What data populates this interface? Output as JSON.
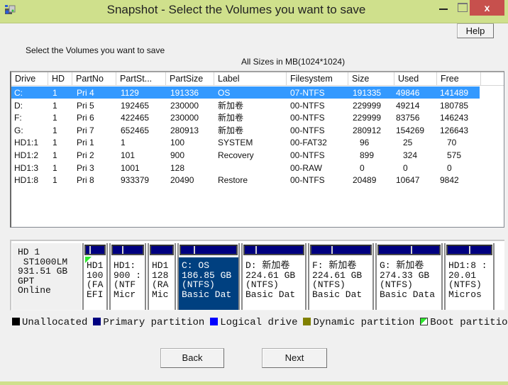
{
  "window": {
    "title": "Snapshot - Select the Volumes you want to save",
    "close_glyph": "x"
  },
  "help_label": "Help",
  "instruction": "Select the Volumes you want to save",
  "sizes_note": "All Sizes in MB(1024*1024)",
  "table": {
    "columns": [
      "Drive",
      "HD",
      "PartNo",
      "PartSt...",
      "PartSize",
      "Label",
      "Filesystem",
      "Size",
      "Used",
      "Free"
    ],
    "rows": [
      {
        "drive": "C:",
        "hd": "1",
        "partno": "Pri  4",
        "partstart": "1129",
        "partsize": "191336",
        "label": "OS",
        "filesystem": "07-NTFS",
        "size": "191335",
        "used": "49846",
        "free": "141489",
        "selected": true
      },
      {
        "drive": "D:",
        "hd": "1",
        "partno": "Pri  5",
        "partstart": "192465",
        "partsize": "230000",
        "label": "新加卷",
        "filesystem": "00-NTFS",
        "size": "229999",
        "used": "49214",
        "free": "180785"
      },
      {
        "drive": "F:",
        "hd": "1",
        "partno": "Pri  6",
        "partstart": "422465",
        "partsize": "230000",
        "label": "新加卷",
        "filesystem": "00-NTFS",
        "size": "229999",
        "used": "83756",
        "free": "146243"
      },
      {
        "drive": "G:",
        "hd": "1",
        "partno": "Pri  7",
        "partstart": "652465",
        "partsize": "280913",
        "label": "新加卷",
        "filesystem": "00-NTFS",
        "size": "280912",
        "used": "154269",
        "free": "126643"
      },
      {
        "drive": "HD1:1",
        "hd": "1",
        "partno": "Pri  1",
        "partstart": "1",
        "partsize": "100",
        "label": "SYSTEM",
        "filesystem": "00-FAT32",
        "size": "96",
        "used": "25",
        "free": "70"
      },
      {
        "drive": "HD1:2",
        "hd": "1",
        "partno": "Pri  2",
        "partstart": "101",
        "partsize": "900",
        "label": "Recovery",
        "filesystem": "00-NTFS",
        "size": "899",
        "used": "324",
        "free": "575"
      },
      {
        "drive": "HD1:3",
        "hd": "1",
        "partno": "Pri  3",
        "partstart": "1001",
        "partsize": "128",
        "label": "",
        "filesystem": "00-RAW",
        "size": "0",
        "used": "0",
        "free": "0"
      },
      {
        "drive": "HD1:8",
        "hd": "1",
        "partno": "Pri  8",
        "partstart": "933379",
        "partsize": "20490",
        "label": "Restore",
        "filesystem": "00-NTFS",
        "size": "20489",
        "used": "10647",
        "free": "9842"
      }
    ]
  },
  "disk": {
    "lines": [
      "HD 1",
      " ST1000LM",
      "931.51 GB",
      "GPT",
      "Online"
    ],
    "partitions": [
      {
        "lines": [
          "HD1",
          "100",
          "(FA",
          "EFI"
        ],
        "used_fraction": 0.26,
        "boot": true
      },
      {
        "lines": [
          "HD1:",
          "900 :",
          "(NTF",
          "Micr"
        ],
        "used_fraction": 0.36
      },
      {
        "lines": [
          "HD1",
          "128",
          "(RA",
          "Mic"
        ],
        "used_fraction": 0.0
      },
      {
        "lines": [
          "C: OS",
          "186.85 GB",
          "(NTFS)",
          "Basic Dat"
        ],
        "used_fraction": 0.26,
        "selected": true
      },
      {
        "lines": [
          "D: 新加卷",
          "224.61 GB",
          "(NTFS)",
          "Basic Dat"
        ],
        "used_fraction": 0.21
      },
      {
        "lines": [
          "F: 新加卷",
          "224.61 GB",
          "(NTFS)",
          "Basic Dat"
        ],
        "used_fraction": 0.36
      },
      {
        "lines": [
          "G: 新加卷",
          "274.33 GB",
          "(NTFS)",
          "Basic Data"
        ],
        "used_fraction": 0.55
      },
      {
        "lines": [
          "HD1:8 :",
          "20.01 ",
          "(NTFS)",
          "Micros"
        ],
        "used_fraction": 0.52
      }
    ]
  },
  "legend": [
    {
      "label": "Unallocated",
      "color": "#000000"
    },
    {
      "label": "Primary partition",
      "color": "#000080"
    },
    {
      "label": "Logical drive",
      "color": "#0000ff"
    },
    {
      "label": "Dynamic partition",
      "color": "#808000"
    },
    {
      "label": "Boot partition",
      "color": "#2ee82e",
      "boot": true
    }
  ],
  "back_label": "Back",
  "next_label": "Next"
}
